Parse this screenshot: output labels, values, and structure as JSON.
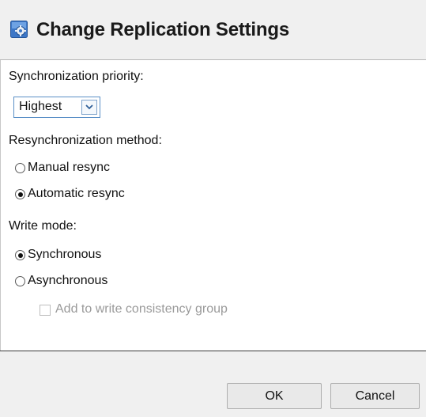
{
  "dialog": {
    "title": "Change Replication Settings",
    "title_icon": "replication-settings-icon"
  },
  "sync_priority": {
    "label": "Synchronization priority:",
    "selected": "Highest"
  },
  "resync_method": {
    "label": "Resynchronization method:",
    "options": [
      {
        "label": "Manual resync",
        "checked": false
      },
      {
        "label": "Automatic resync",
        "checked": true
      }
    ]
  },
  "write_mode": {
    "label": "Write mode:",
    "options": [
      {
        "label": "Synchronous",
        "checked": true
      },
      {
        "label": "Asynchronous",
        "checked": false
      }
    ],
    "consistency_group": {
      "label": "Add to write consistency group",
      "checked": false,
      "enabled": false
    }
  },
  "buttons": {
    "ok": "OK",
    "cancel": "Cancel"
  },
  "colors": {
    "header_bg": "#f0f0f0",
    "select_border": "#5a8fc7",
    "disabled_text": "#9a9a9a"
  }
}
